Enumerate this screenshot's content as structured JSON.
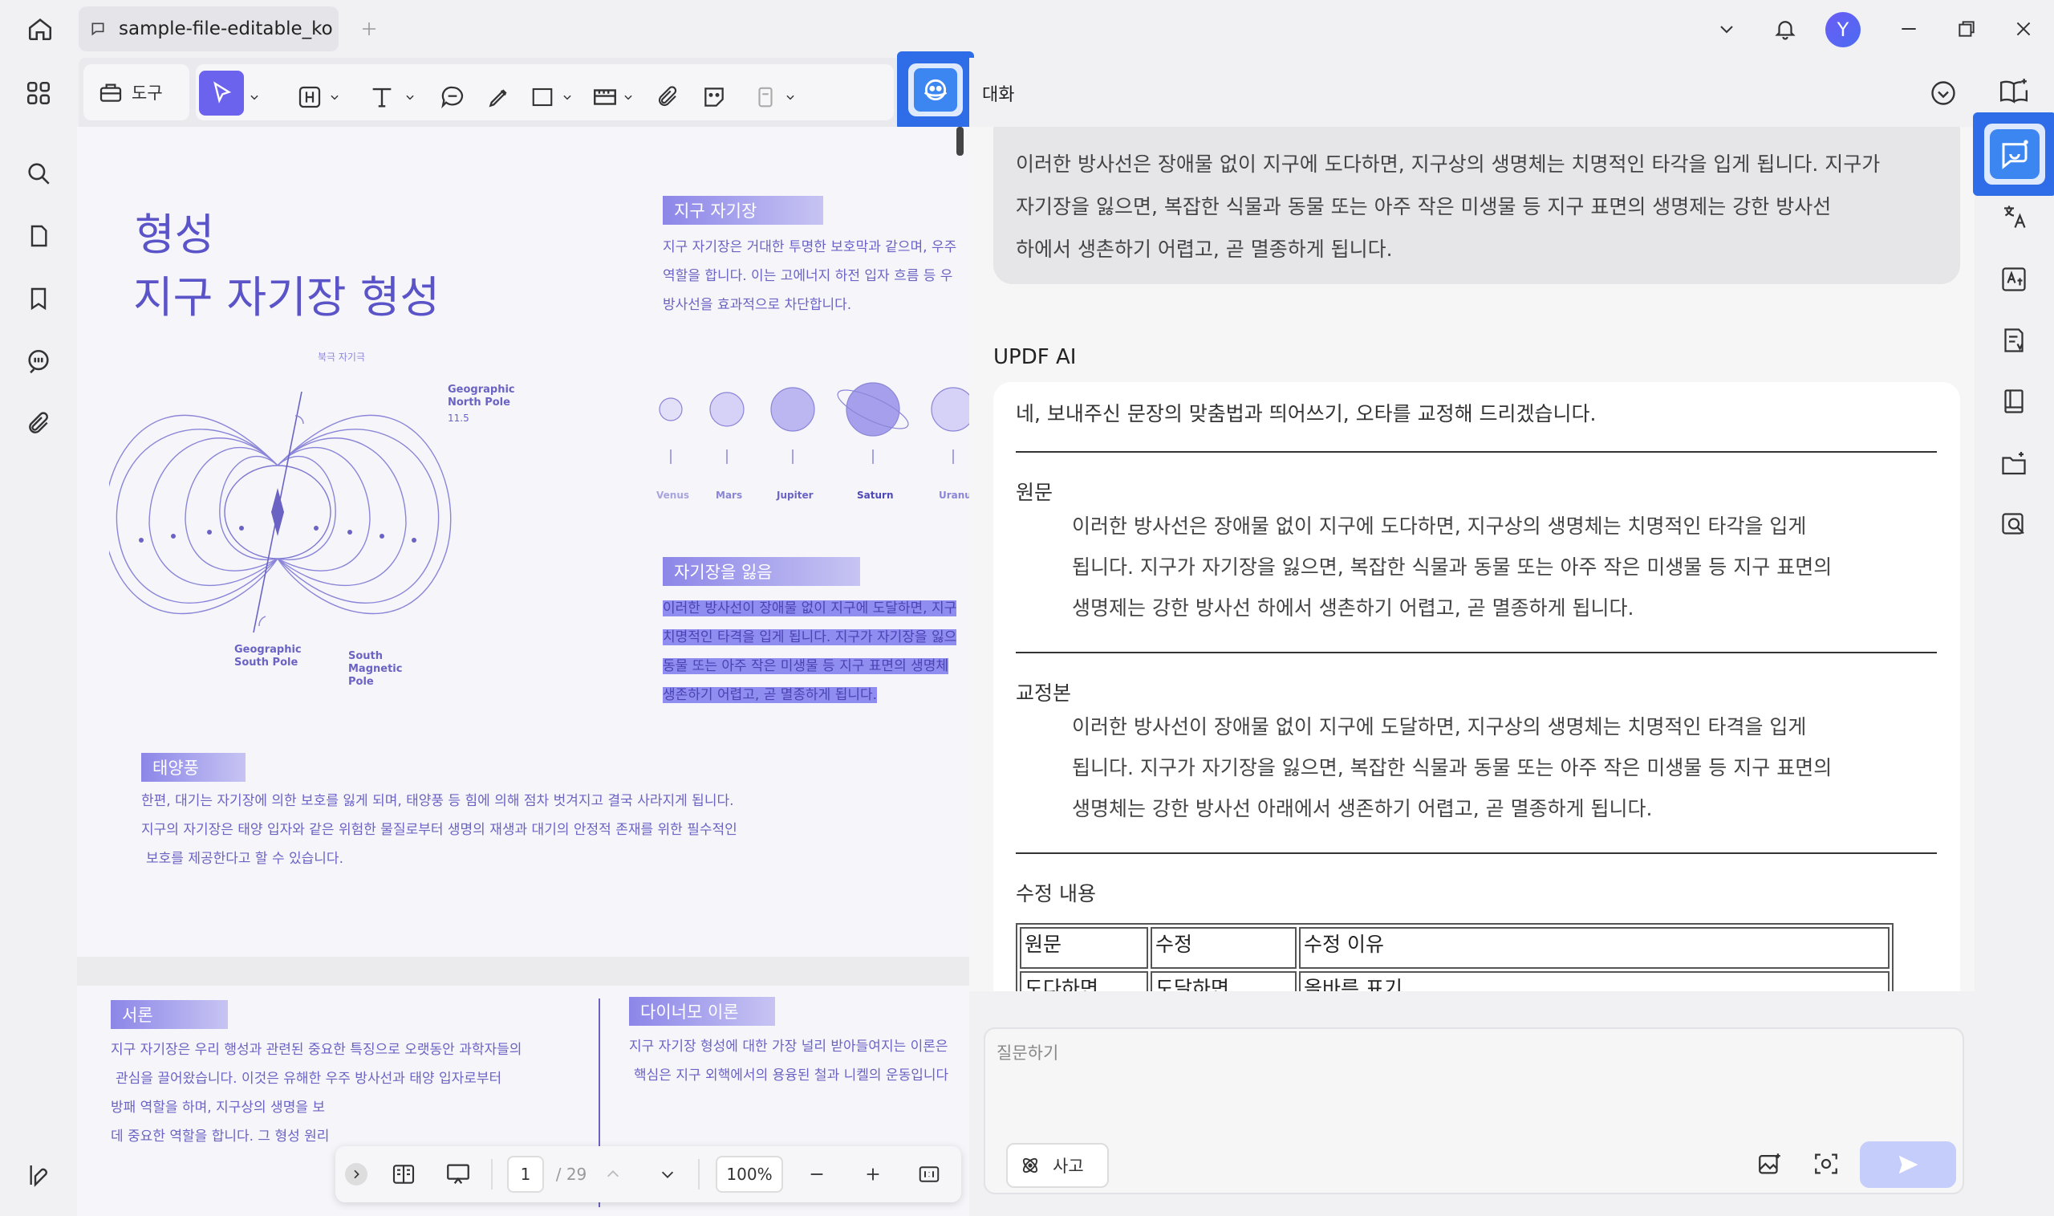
{
  "app": {
    "tab_title": "sample-file-editable_ko",
    "avatar_initial": "Y",
    "accent_color": "#2e6ce8",
    "brand_purple": "#6b5cf6"
  },
  "toolbar": {
    "tools_label": "도구",
    "chat_label": "대화"
  },
  "document": {
    "title_line1": "형성",
    "title_line2": "지구 자기장 형성",
    "diagram_top_label": "북극 자기극",
    "geo_north": "Geographic\nNorth Pole",
    "geo_south": "Geographic\nSouth Pole",
    "mag_south": "South\nMagnetic\nPole",
    "angle_label": "11.5",
    "planets": [
      "Venus",
      "Mars",
      "Jupiter",
      "Saturn",
      "Uranu"
    ],
    "sec1_tag": "지구 자기장",
    "sec1_lines": [
      "지구 자기장은 거대한 투명한 보호막과 같으며, 우주",
      "역할을 합니다. 이는 고에너지 하전 입자 흐름 등 우",
      "방사선을 효과적으로 차단합니다."
    ],
    "sec2_tag": "자기장을 잃음",
    "sec2_lines": [
      "이러한 방사선이 장애물 없이 지구에 도달하면, 지구",
      "치명적인 타격을 입게 됩니다. 지구가 자기장을 잃으",
      "동물 또는 아주 작은 미생물 등 지구 표면의 생명체",
      "생존하기 어렵고, 곧 멸종하게 됩니다."
    ],
    "sec3_tag": "태양풍",
    "sec3_lines": [
      "한편, 대기는 자기장에 의한 보호를 잃게 되며, 태양풍 등 힘에 의해 점차 벗겨지고 결국 사라지게 됩니다.",
      "지구의 자기장은 태양 입자와 같은 위험한 물질로부터 생명의 재생과 대기의 안정적 존재를 위한 필수적인",
      "보호를 제공한다고 할 수 있습니다."
    ],
    "p2_tag1": "서론",
    "p2_lines1": [
      "지구 자기장은 우리 행성과 관련된 중요한 특징으로 오랫동안 과학자들의",
      "관심을 끌어왔습니다. 이것은 유해한 우주 방사선과 태양 입자로부터",
      "방패 역할을 하며, 지구상의 생명을 보",
      "데 중요한 역할을 합니다. 그 형성 원리"
    ],
    "p2_tag2": "다이너모 이론",
    "p2_lines2": [
      "지구 자기장 형성에 대한 가장 널리 받아들여지는 이론은",
      "핵심은 지구 외핵에서의 용융된 철과 니켈의 운동입니다",
      "",
      ""
    ]
  },
  "navbar": {
    "page_current": "1",
    "page_total": "/ 29",
    "zoom": "100%"
  },
  "chat": {
    "user_message_lines": [
      "이러한 방사선은 장애물 없이 지구에 도다하면, 지구상의 생명체는 치명적인 타각을 입게 됩니다. 지구가",
      "자기장을 잃으면, 복잡한 식물과 동물 또는 아주 작은 미생물 등 지구 표면의 생명제는 강한 방사선",
      "하에서 생촌하기 어렵고, 곧 멸종하게 됩니다."
    ],
    "ai_name": "UPDF AI",
    "ai_intro": "네, 보내주신 문장의 맞춤법과 띄어쓰기, 오타를 교정해 드리겠습니다.",
    "original_heading": "원문",
    "original_lines": [
      "이러한 방사선은 장애물 없이 지구에 도다하면, 지구상의 생명체는 치명적인 타각을 입게",
      "됩니다. 지구가 자기장을 잃으면, 복잡한 식물과 동물 또는 아주 작은 미생물 등 지구 표면의",
      "생명제는 강한 방사선 하에서 생촌하기 어렵고, 곧 멸종하게 됩니다."
    ],
    "corrected_heading": "교정본",
    "corrected_lines": [
      "이러한 방사선이 장애물 없이 지구에 도달하면, 지구상의 생명체는 치명적인 타격을 입게",
      "됩니다. 지구가 자기장을 잃으면, 복잡한 식물과 동물 또는 아주 작은 미생물 등 지구 표면의",
      "생명체는 강한 방사선 아래에서 생존하기 어렵고, 곧 멸종하게 됩니다."
    ],
    "changes_heading": "수정 내용",
    "table_headers": [
      "원문",
      "수정",
      "수정 이유"
    ],
    "table_rows": [
      [
        "도다하면",
        "도달하면",
        "올바른 표기"
      ]
    ],
    "input_placeholder": "질문하기",
    "think_label": "사고"
  }
}
